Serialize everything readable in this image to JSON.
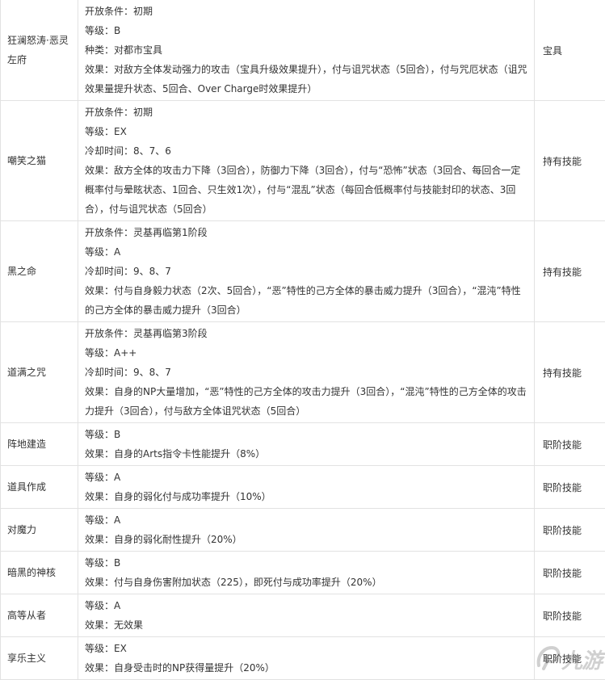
{
  "rows": [
    {
      "name": "狂澜怒涛·恶灵左府",
      "lines": [
        "开放条件：初期",
        "等级：B",
        "种类：对都市宝具",
        "效果：对敌方全体发动强力的攻击（宝具升级效果提升），付与诅咒状态（5回合），付与咒厄状态（诅咒效果量提升状态、5回合、Over Charge时效果提升）"
      ],
      "type": "宝具"
    },
    {
      "name": "嘲笑之猫",
      "lines": [
        "开放条件：初期",
        "等级：EX",
        "冷却时间：8、7、6",
        "效果：敌方全体的攻击力下降（3回合），防御力下降（3回合），付与“恐怖”状态（3回合、每回合一定概率付与晕眩状态、1回合、只生效1次），付与“混乱”状态（每回合低概率付与技能封印的状态、3回合），付与诅咒状态（5回合）"
      ],
      "type": "持有技能"
    },
    {
      "name": "黑之命",
      "lines": [
        "开放条件：灵基再临第1阶段",
        "等级：A",
        "冷却时间：9、8、7",
        "效果：付与自身毅力状态（2次、5回合），“恶”特性的己方全体的暴击威力提升（3回合），“混沌”特性的己方全体的暴击威力提升（3回合）"
      ],
      "type": "持有技能"
    },
    {
      "name": "道满之咒",
      "lines": [
        "开放条件：灵基再临第3阶段",
        "等级：A++",
        "冷却时间：9、8、7",
        "效果：自身的NP大量增加，“恶”特性的己方全体的攻击力提升（3回合），“混沌”特性的己方全体的攻击力提升（3回合），付与敌方全体诅咒状态（5回合）"
      ],
      "type": "持有技能"
    },
    {
      "name": "阵地建造",
      "lines": [
        "等级：B",
        "效果：自身的Arts指令卡性能提升（8%）"
      ],
      "type": "职阶技能"
    },
    {
      "name": "道具作成",
      "lines": [
        "等级：A",
        "效果：自身的弱化付与成功率提升（10%）"
      ],
      "type": "职阶技能"
    },
    {
      "name": "对魔力",
      "lines": [
        "等级：A",
        "效果：自身的弱化耐性提升（20%）"
      ],
      "type": "职阶技能"
    },
    {
      "name": "暗黑的神核",
      "lines": [
        "等级：B",
        "效果：付与自身伤害附加状态（225），即死付与成功率提升（20%）"
      ],
      "type": "职阶技能"
    },
    {
      "name": "高等从者",
      "lines": [
        "等级：A",
        "效果：无效果"
      ],
      "type": "职阶技能"
    },
    {
      "name": "享乐主义",
      "lines": [
        "等级：EX",
        "效果：自身受击时的NP获得量提升（20%）"
      ],
      "type": "职阶技能"
    }
  ],
  "watermark": {
    "text": "九游",
    "logo_icon": "nine-game-logo-icon"
  }
}
